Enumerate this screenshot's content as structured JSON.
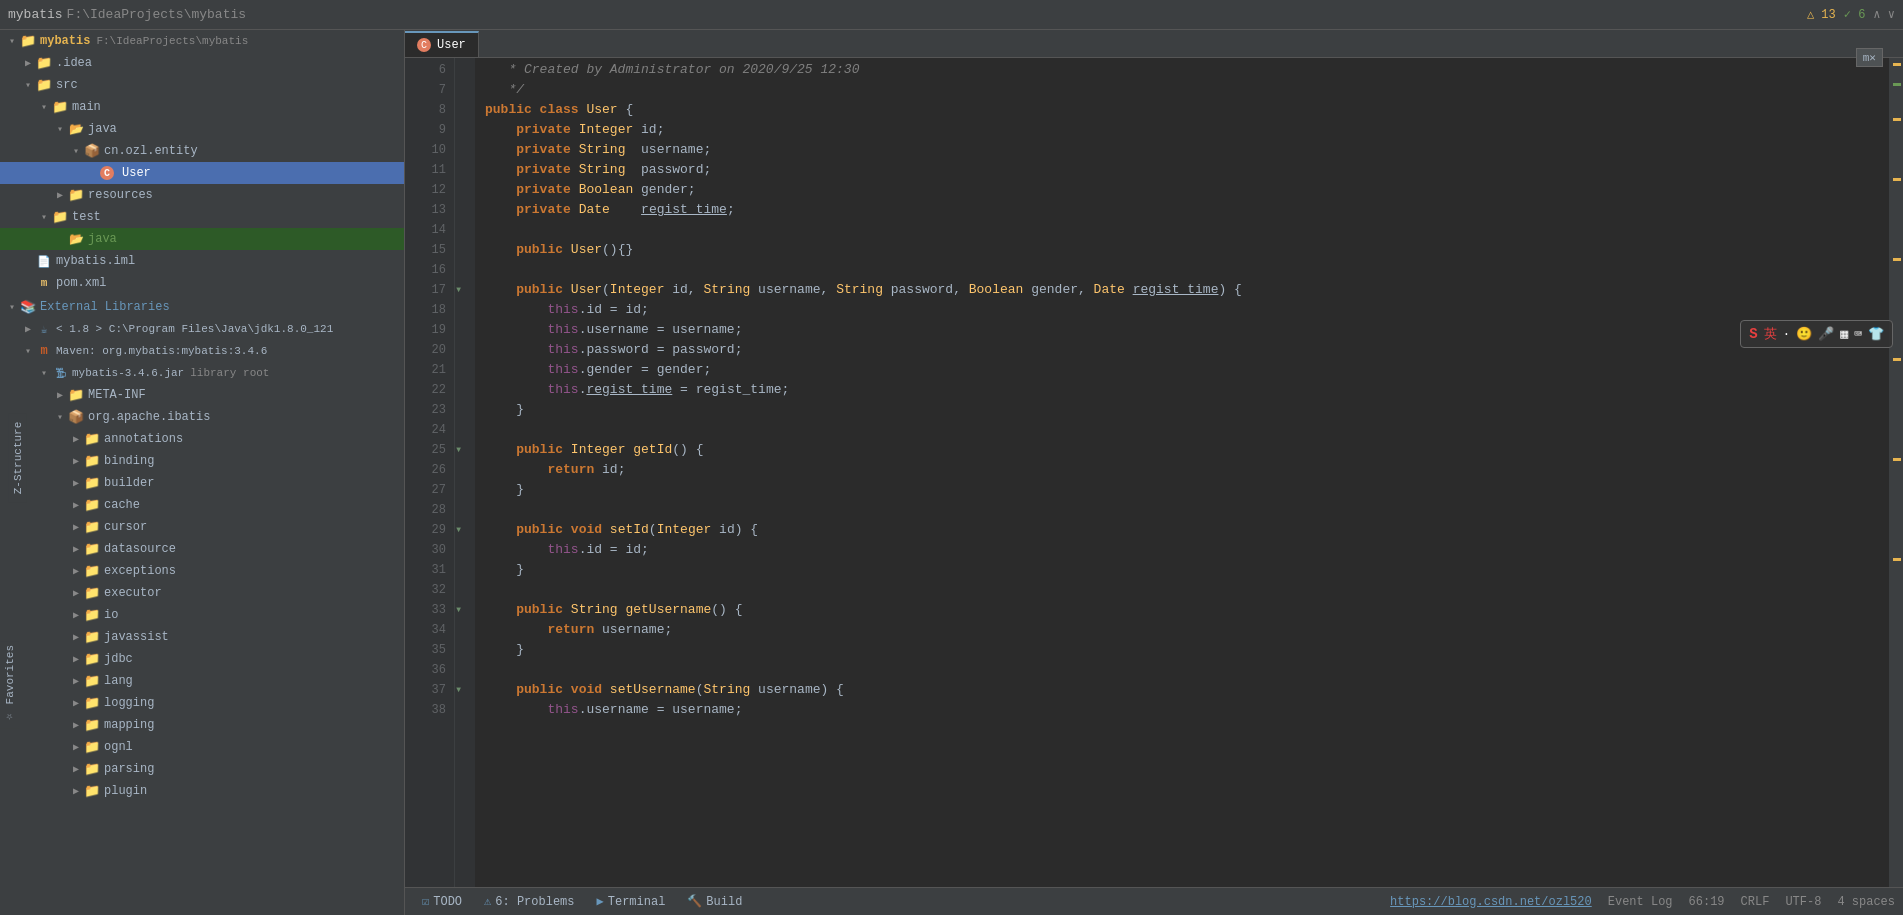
{
  "app": {
    "title": "mybatis",
    "path": "F:\\IdeaProjects\\mybatis",
    "warnings": "△ 13",
    "ok_checks": "✓ 6"
  },
  "tabs": {
    "active_tab": "User",
    "items": [
      {
        "label": "User",
        "active": true
      }
    ]
  },
  "tree": {
    "project_name": "mybatis",
    "project_path": "F:\\IdeaProjects\\mybatis",
    "items": [
      {
        "id": "mybatis",
        "level": 0,
        "label": "mybatis",
        "type": "project",
        "expanded": true
      },
      {
        "id": "idea",
        "level": 1,
        "label": ".idea",
        "type": "folder",
        "expanded": false
      },
      {
        "id": "src",
        "level": 1,
        "label": "src",
        "type": "folder",
        "expanded": true
      },
      {
        "id": "main",
        "level": 2,
        "label": "main",
        "type": "folder",
        "expanded": true
      },
      {
        "id": "java",
        "level": 3,
        "label": "java",
        "type": "source-folder",
        "expanded": true
      },
      {
        "id": "cn.ozl.entity",
        "level": 4,
        "label": "cn.ozl.entity",
        "type": "package",
        "expanded": true
      },
      {
        "id": "User",
        "level": 5,
        "label": "User",
        "type": "class",
        "expanded": false,
        "selected": true
      },
      {
        "id": "resources",
        "level": 3,
        "label": "resources",
        "type": "folder",
        "expanded": false
      },
      {
        "id": "test",
        "level": 2,
        "label": "test",
        "type": "folder",
        "expanded": true
      },
      {
        "id": "java2",
        "level": 3,
        "label": "java",
        "type": "source-folder",
        "highlighted": true
      },
      {
        "id": "mybatis.iml",
        "level": 1,
        "label": "mybatis.iml",
        "type": "iml"
      },
      {
        "id": "pom.xml",
        "level": 1,
        "label": "pom.xml",
        "type": "xml"
      },
      {
        "id": "external-libs",
        "level": 0,
        "label": "External Libraries",
        "type": "libs",
        "expanded": true
      },
      {
        "id": "jdk",
        "level": 1,
        "label": "< 1.8 > C:\\Program Files\\Java\\jdk1.8.0_121",
        "type": "jdk",
        "expanded": false
      },
      {
        "id": "maven-mybatis",
        "level": 1,
        "label": "Maven: org.mybatis:mybatis:3.4.6",
        "type": "maven",
        "expanded": true
      },
      {
        "id": "mybatis-jar",
        "level": 2,
        "label": "mybatis-3.4.6.jar",
        "type": "jar",
        "suffix": "library root",
        "expanded": true
      },
      {
        "id": "META-INF",
        "level": 3,
        "label": "META-INF",
        "type": "folder",
        "expanded": false
      },
      {
        "id": "org.apache.ibatis",
        "level": 3,
        "label": "org.apache.ibatis",
        "type": "package",
        "expanded": true
      },
      {
        "id": "annotations",
        "level": 4,
        "label": "annotations",
        "type": "folder",
        "expanded": false
      },
      {
        "id": "binding",
        "level": 4,
        "label": "binding",
        "type": "folder",
        "expanded": false
      },
      {
        "id": "builder",
        "level": 4,
        "label": "builder",
        "type": "folder",
        "expanded": false
      },
      {
        "id": "cache",
        "level": 4,
        "label": "cache",
        "type": "folder",
        "expanded": false
      },
      {
        "id": "cursor",
        "level": 4,
        "label": "cursor",
        "type": "folder",
        "expanded": false
      },
      {
        "id": "datasource",
        "level": 4,
        "label": "datasource",
        "type": "folder",
        "expanded": false
      },
      {
        "id": "exceptions",
        "level": 4,
        "label": "exceptions",
        "type": "folder",
        "expanded": false
      },
      {
        "id": "executor",
        "level": 4,
        "label": "executor",
        "type": "folder",
        "expanded": false
      },
      {
        "id": "io",
        "level": 4,
        "label": "io",
        "type": "folder",
        "expanded": false
      },
      {
        "id": "javassist",
        "level": 4,
        "label": "javassist",
        "type": "folder",
        "expanded": false
      },
      {
        "id": "jdbc",
        "level": 4,
        "label": "jdbc",
        "type": "folder",
        "expanded": false
      },
      {
        "id": "lang",
        "level": 4,
        "label": "lang",
        "type": "folder",
        "expanded": false
      },
      {
        "id": "logging",
        "level": 4,
        "label": "logging",
        "type": "folder",
        "expanded": false
      },
      {
        "id": "mapping",
        "level": 4,
        "label": "mapping",
        "type": "folder",
        "expanded": false
      },
      {
        "id": "ognl",
        "level": 4,
        "label": "ognl",
        "type": "folder",
        "expanded": false
      },
      {
        "id": "parsing",
        "level": 4,
        "label": "parsing",
        "type": "folder",
        "expanded": false
      },
      {
        "id": "plugin",
        "level": 4,
        "label": "plugin",
        "type": "folder",
        "expanded": false
      }
    ]
  },
  "code": {
    "filename": "User",
    "lines": [
      {
        "num": 6,
        "content": "   * Created by Administrator on 2020/9/25 12:30",
        "type": "comment"
      },
      {
        "num": 7,
        "content": "   */",
        "type": "comment"
      },
      {
        "num": 8,
        "content": "public class User {",
        "type": "code"
      },
      {
        "num": 9,
        "content": "    private Integer id;",
        "type": "code"
      },
      {
        "num": 10,
        "content": "    private String  username;",
        "type": "code"
      },
      {
        "num": 11,
        "content": "    private String  password;",
        "type": "code"
      },
      {
        "num": 12,
        "content": "    private Boolean gender;",
        "type": "code"
      },
      {
        "num": 13,
        "content": "    private Date    regist_time;",
        "type": "code"
      },
      {
        "num": 14,
        "content": "",
        "type": "blank"
      },
      {
        "num": 15,
        "content": "    public User(){}",
        "type": "code"
      },
      {
        "num": 16,
        "content": "",
        "type": "blank"
      },
      {
        "num": 17,
        "content": "    public User(Integer id, String username, String password, Boolean gender, Date regist_time) {",
        "type": "code"
      },
      {
        "num": 18,
        "content": "        this.id = id;",
        "type": "code"
      },
      {
        "num": 19,
        "content": "        this.username = username;",
        "type": "code"
      },
      {
        "num": 20,
        "content": "        this.password = password;",
        "type": "code"
      },
      {
        "num": 21,
        "content": "        this.gender = gender;",
        "type": "code"
      },
      {
        "num": 22,
        "content": "        this.regist_time = regist_time;",
        "type": "code"
      },
      {
        "num": 23,
        "content": "    }",
        "type": "code"
      },
      {
        "num": 24,
        "content": "",
        "type": "blank"
      },
      {
        "num": 25,
        "content": "    public Integer getId() {",
        "type": "code"
      },
      {
        "num": 26,
        "content": "        return id;",
        "type": "code"
      },
      {
        "num": 27,
        "content": "    }",
        "type": "code"
      },
      {
        "num": 28,
        "content": "",
        "type": "blank"
      },
      {
        "num": 29,
        "content": "    public void setId(Integer id) {",
        "type": "code"
      },
      {
        "num": 30,
        "content": "        this.id = id;",
        "type": "code"
      },
      {
        "num": 31,
        "content": "    }",
        "type": "code"
      },
      {
        "num": 32,
        "content": "",
        "type": "blank"
      },
      {
        "num": 33,
        "content": "    public String getUsername() {",
        "type": "code"
      },
      {
        "num": 34,
        "content": "        return username;",
        "type": "code"
      },
      {
        "num": 35,
        "content": "    }",
        "type": "code"
      },
      {
        "num": 36,
        "content": "",
        "type": "blank"
      },
      {
        "num": 37,
        "content": "    public void setUsername(String username) {",
        "type": "code"
      },
      {
        "num": 38,
        "content": "        this.username = username;",
        "type": "code"
      }
    ]
  },
  "status_bar": {
    "todo_label": "TODO",
    "problems_label": "6: Problems",
    "terminal_label": "Terminal",
    "build_label": "Build",
    "position": "66:19",
    "encoding": "CRLF",
    "charset": "UTF-8",
    "indent": "4 spaces",
    "url": "https://blog.csdn.net/ozl520",
    "event_log": "Event Log"
  },
  "plugin_button": {
    "label": "m✕"
  }
}
